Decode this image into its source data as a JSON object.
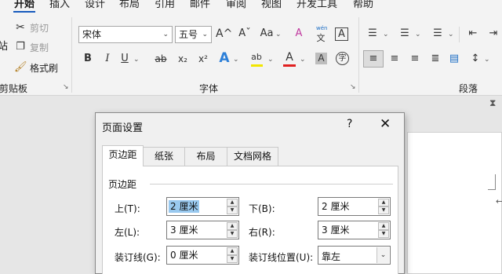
{
  "ribbon": {
    "tabs": [
      "开始",
      "插入",
      "设计",
      "布局",
      "引用",
      "邮件",
      "审阅",
      "视图",
      "开发工具",
      "帮助"
    ],
    "active_tab": "开始",
    "accent_color": "#185abd",
    "clipboard": {
      "cut": "剪切",
      "copy": "复制",
      "format_painter": "格式刷",
      "paste_partial": "站",
      "label": "剪贴板"
    },
    "font": {
      "font_name": "宋体",
      "font_size": "五号",
      "grow_icon": "A^",
      "shrink_icon": "Aˇ",
      "case_icon": "Aa",
      "clear_format_icon": "A",
      "phonetic_small": "wén",
      "phonetic_char": "文",
      "border_char_icon": "A",
      "bold": "B",
      "italic": "I",
      "underline": "U",
      "strikethrough": "ab",
      "subscript": "x₂",
      "superscript": "x²",
      "text_effect": "A",
      "highlight": "ab",
      "font_color": "A",
      "char_shading": "A",
      "enclose_char": "字",
      "label": "字体",
      "highlight_color": "#f2e600",
      "font_color_bar": "#e02020"
    },
    "paragraph": {
      "label": "段落"
    }
  },
  "dialog": {
    "title": "页面设置",
    "help": "?",
    "close": "✕",
    "tabs": [
      "页边距",
      "纸张",
      "布局",
      "文档网格"
    ],
    "active_tab": "页边距",
    "section_title": "页边距",
    "fields": {
      "top": {
        "label": "上(T):",
        "value": "2 厘米"
      },
      "bottom": {
        "label": "下(B):",
        "value": "2 厘米"
      },
      "left": {
        "label": "左(L):",
        "value": "3 厘米"
      },
      "right": {
        "label": "右(R):",
        "value": "3 厘米"
      },
      "gutter": {
        "label": "装订线(G):",
        "value": "0 厘米"
      },
      "gutter_position": {
        "label": "装订线位置(U):",
        "value": "靠左"
      }
    }
  }
}
